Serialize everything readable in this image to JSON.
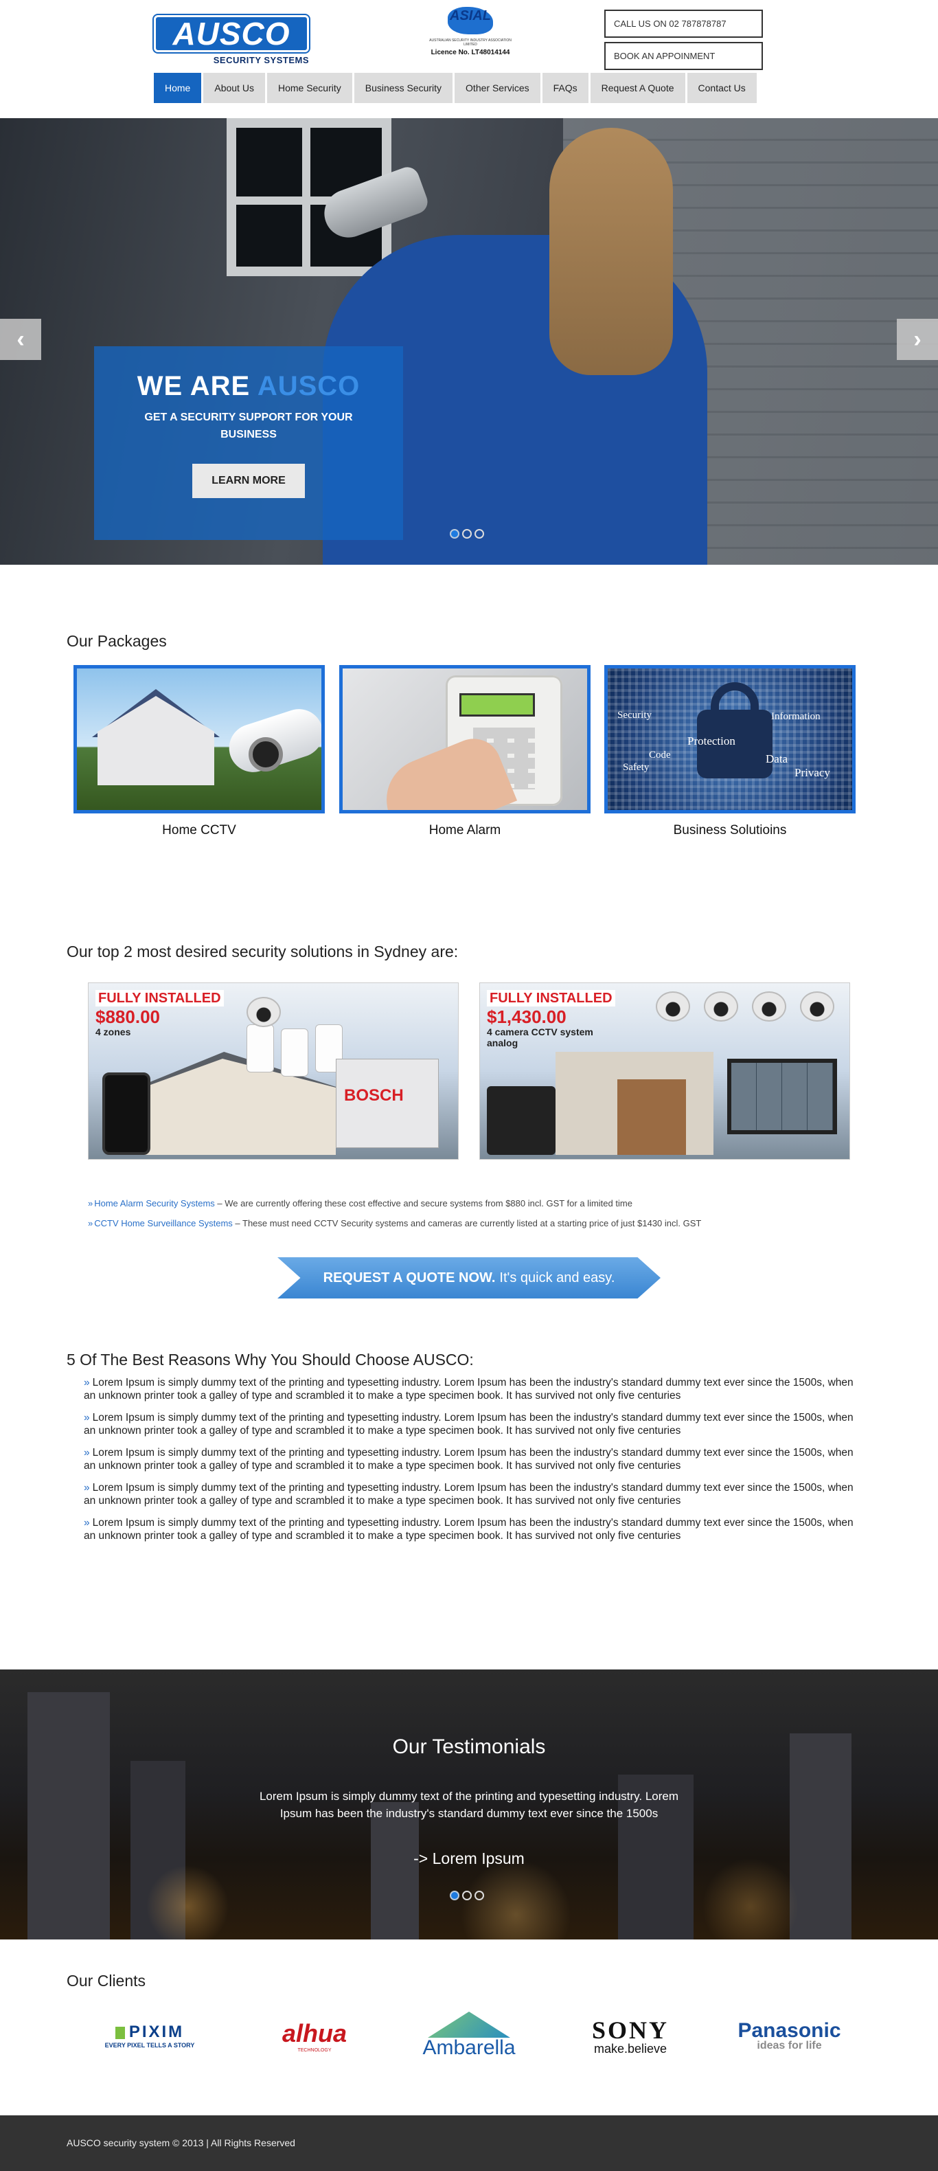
{
  "header": {
    "logo_text": "AUSCO",
    "logo_sub": "SECURITY SYSTEMS",
    "asial_text": "ASIAL",
    "asial_small": "AUSTRALIAN SECURITY INDUSTRY ASSOCIATION LIMITED",
    "licence": "Licence No. LT48014144",
    "call_label": "CALL US ON 02 787878787",
    "book_label": "BOOK AN APPOINMENT"
  },
  "nav": {
    "items": [
      {
        "label": "Home"
      },
      {
        "label": "About Us"
      },
      {
        "label": "Home Security"
      },
      {
        "label": "Business Security"
      },
      {
        "label": "Other Services"
      },
      {
        "label": "FAQs"
      },
      {
        "label": "Request A Quote"
      },
      {
        "label": "Contact Us"
      }
    ],
    "active": "Home"
  },
  "hero": {
    "title_prefix": "WE ARE ",
    "title_accent": "AUSCO",
    "subtitle": "GET A SECURITY SUPPORT FOR YOUR BUSINESS",
    "button": "LEARN MORE",
    "prev_icon": "chevron-left-icon",
    "next_icon": "chevron-right-icon",
    "prev_glyph": "‹",
    "next_glyph": "›",
    "slides": 3,
    "active_slide": 1
  },
  "packages": {
    "title": "Our Packages",
    "items": [
      {
        "label": "Home CCTV"
      },
      {
        "label": "Home Alarm"
      },
      {
        "label": "Business Solutioins"
      }
    ],
    "business_words": [
      "Security",
      "Code",
      "Safety",
      "Protection",
      "Information",
      "Data",
      "Privacy"
    ]
  },
  "top2": {
    "title": "Our top 2 most desired security solutions in Sydney are:",
    "promo1": {
      "l1": "FULLY INSTALLED",
      "l2": "$880.00",
      "l3": "4 zones",
      "brand": "BOSCH"
    },
    "promo2": {
      "l1": "FULLY INSTALLED",
      "l2": "$1,430.00",
      "l3": "4 camera CCTV system",
      "l4": "analog"
    },
    "bullets": [
      {
        "link": "Home Alarm Security Systems",
        "text": " – We are currently offering these cost effective and secure systems from $880 incl. GST for a limited time"
      },
      {
        "link": "CCTV Home Surveillance Systems",
        "text": " – These must need CCTV Security systems and cameras are currently listed at a starting price of just $1430 incl. GST"
      }
    ],
    "bullet_mark": "»"
  },
  "quote": {
    "strong": "REQUEST A QUOTE NOW.",
    "rest": "It's quick and easy."
  },
  "reasons": {
    "title": "5 Of The Best Reasons Why You Should Choose AUSCO:",
    "mark": "»",
    "items": [
      "Lorem Ipsum is simply dummy text of the printing and typesetting industry. Lorem Ipsum has been the industry's standard dummy text ever since the 1500s, when an unknown printer took a galley of type and scrambled it to make a type specimen book. It has survived not only five centuries",
      "Lorem Ipsum is simply dummy text of the printing and typesetting industry. Lorem Ipsum has been the industry's standard dummy text ever since the 1500s, when an unknown printer took a galley of type and scrambled it to make a type specimen book. It has survived not only five centuries",
      "Lorem Ipsum is simply dummy text of the printing and typesetting industry. Lorem Ipsum has been the industry's standard dummy text ever since the 1500s, when an unknown printer took a galley of type and scrambled it to make a type specimen book. It has survived not only five centuries",
      "Lorem Ipsum is simply dummy text of the printing and typesetting industry. Lorem Ipsum has been the industry's standard dummy text ever since the 1500s, when an unknown printer took a galley of type and scrambled it to make a type specimen book. It has survived not only five centuries",
      "Lorem Ipsum is simply dummy text of the printing and typesetting industry. Lorem Ipsum has been the industry's standard dummy text ever since the 1500s, when an unknown printer took a galley of type and scrambled it to make a type specimen book. It has survived not only five centuries"
    ]
  },
  "testimonials": {
    "title": "Our Testimonials",
    "text": "Lorem Ipsum is simply dummy text of the printing and typesetting industry. Lorem Ipsum has been the industry's standard dummy text ever since the 1500s",
    "author": "-> Lorem Ipsum",
    "slides": 3,
    "active_slide": 1
  },
  "clients": {
    "title": "Our Clients",
    "pixim": {
      "name": "PIXIM",
      "tag": "EVERY PIXEL TELLS A STORY"
    },
    "dahua": {
      "name": "alhua",
      "tag": "TECHNOLOGY"
    },
    "ambarella": {
      "name": "Ambarella"
    },
    "sony": {
      "name": "SONY",
      "tag": "make.believe"
    },
    "panasonic": {
      "name": "Panasonic",
      "tag": "ideas for life"
    }
  },
  "footer": {
    "text": "AUSCO security system © 2013 | All Rights Reserved"
  },
  "colors": {
    "brand_blue": "#1565c0",
    "accent_blue": "#3a8ee6",
    "link_blue": "#2a70c8",
    "footer": "#333333"
  }
}
